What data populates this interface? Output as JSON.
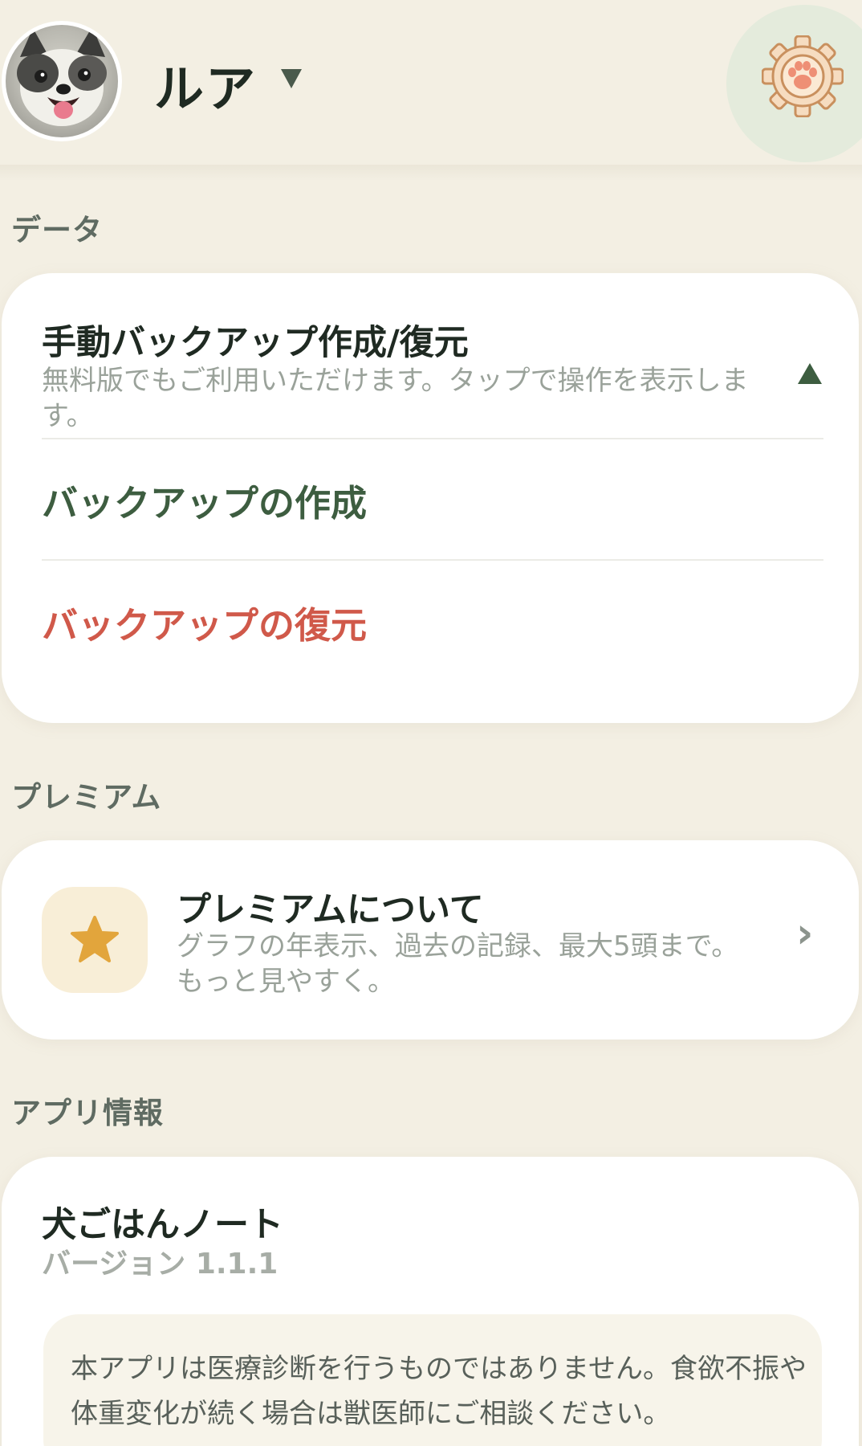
{
  "header": {
    "pet_name": "ルア",
    "avatar_icon": "dog-avatar",
    "settings_icon": "paw-gear-icon"
  },
  "sections": {
    "data_label": "データ",
    "premium_label": "プレミアム",
    "app_info_label": "アプリ情報"
  },
  "backup_card": {
    "title": "手動バックアップ作成/復元",
    "subtitle": "無料版でもご利用いただけます。タップで操作を表示します。",
    "create_label": "バックアップの作成",
    "restore_label": "バックアップの復元"
  },
  "premium_card": {
    "title": "プレミアムについて",
    "subtitle": "グラフの年表示、過去の記録、最大5頭まで。もっと見やすく。",
    "icon": "star-icon",
    "chevron": "›"
  },
  "app_info_card": {
    "app_name": "犬ごはんノート",
    "version": "バージョン 1.1.1",
    "notice": "本アプリは医療診断を行うものではありません。食欲不振や体重変化が続く場合は獣医師にご相談ください。"
  },
  "colors": {
    "background": "#f3efe3",
    "card": "#ffffff",
    "accent_green": "#3d5d40",
    "danger_red": "#d0594a",
    "star_gold": "#e2a53c"
  }
}
